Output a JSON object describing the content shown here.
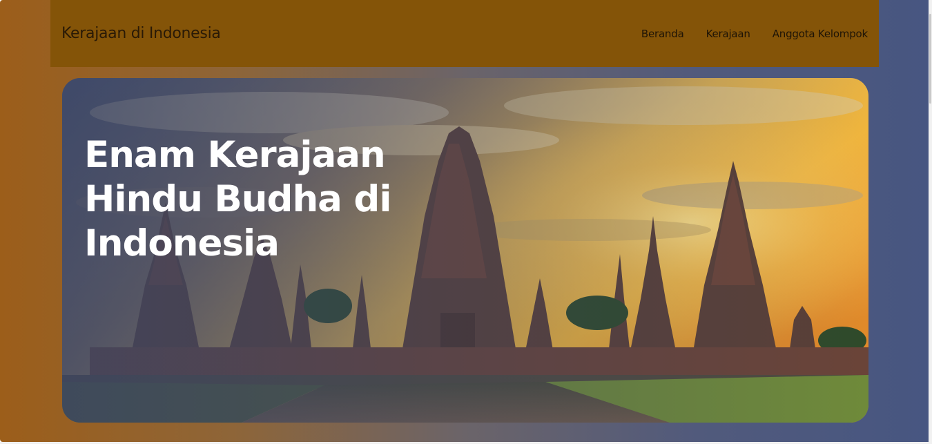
{
  "navbar": {
    "brand": "Kerajaan di Indonesia",
    "links": [
      {
        "label": "Beranda"
      },
      {
        "label": "Kerajaan"
      },
      {
        "label": "Anggota Kelompok"
      }
    ]
  },
  "hero": {
    "title": "Enam Kerajaan Hindu Budha di Indonesia",
    "image_subject": "temple-ruins-at-sunset"
  },
  "colors": {
    "navbar_bg": "#845408",
    "gradient_left": "#9c5e1a",
    "gradient_right": "#475681",
    "hero_text": "#ffffff"
  }
}
